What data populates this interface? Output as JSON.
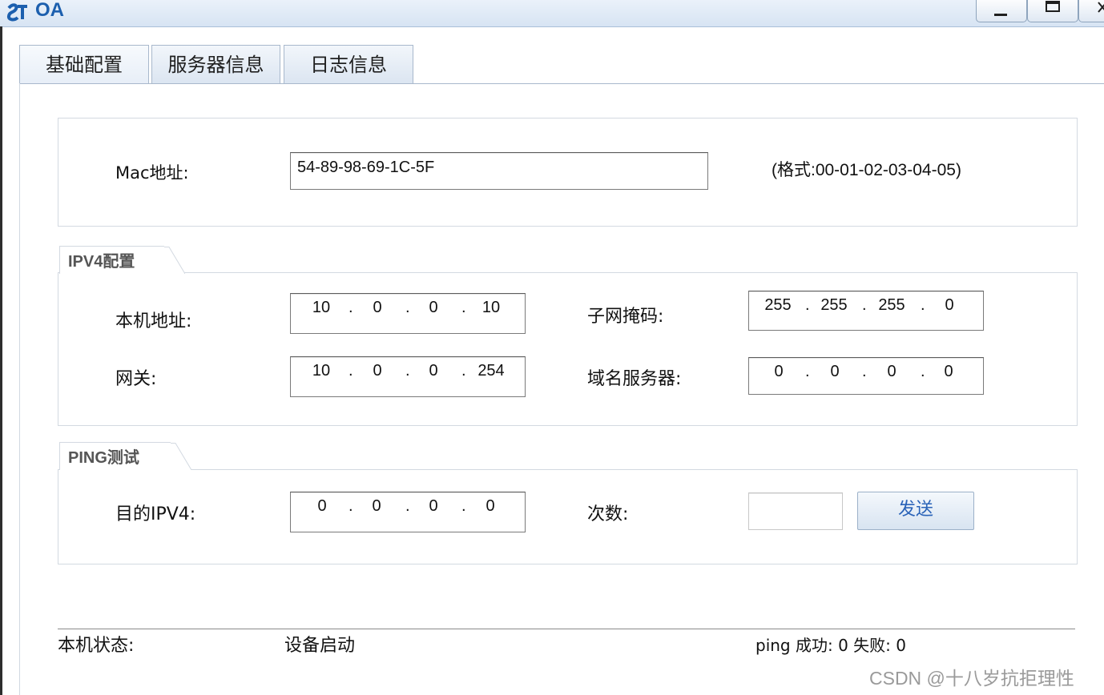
{
  "window": {
    "title": "OA",
    "controls": [
      "minimize-icon",
      "maximize-icon",
      "close-icon"
    ]
  },
  "tabs": [
    {
      "label": "基础配置",
      "active": true
    },
    {
      "label": "服务器信息",
      "active": false
    },
    {
      "label": "日志信息",
      "active": false
    }
  ],
  "mac": {
    "label": "Mac地址:",
    "value": "54-89-98-69-1C-5F",
    "format_hint": "(格式:00-01-02-03-04-05)"
  },
  "ipv4": {
    "group_title": "IPV4配置",
    "local_ip_label": "本机地址:",
    "local_ip": [
      "10",
      "0",
      "0",
      "10"
    ],
    "subnet_label": "子网掩码:",
    "subnet": [
      "255",
      "255",
      "255",
      "0"
    ],
    "gateway_label": "网关:",
    "gateway": [
      "10",
      "0",
      "0",
      "254"
    ],
    "dns_label": "域名服务器:",
    "dns": [
      "0",
      "0",
      "0",
      "0"
    ]
  },
  "ping": {
    "group_title": "PING测试",
    "target_label": "目的IPV4:",
    "target": [
      "0",
      "0",
      "0",
      "0"
    ],
    "count_label": "次数:",
    "count_value": "",
    "send_label": "发送"
  },
  "status": {
    "label": "本机状态:",
    "value": "设备启动",
    "ping_result": "ping 成功: 0 失败: 0"
  },
  "watermark": "CSDN @十八岁抗拒理性",
  "colors": {
    "accent": "#1c5fae",
    "button_text": "#2a63b8"
  }
}
